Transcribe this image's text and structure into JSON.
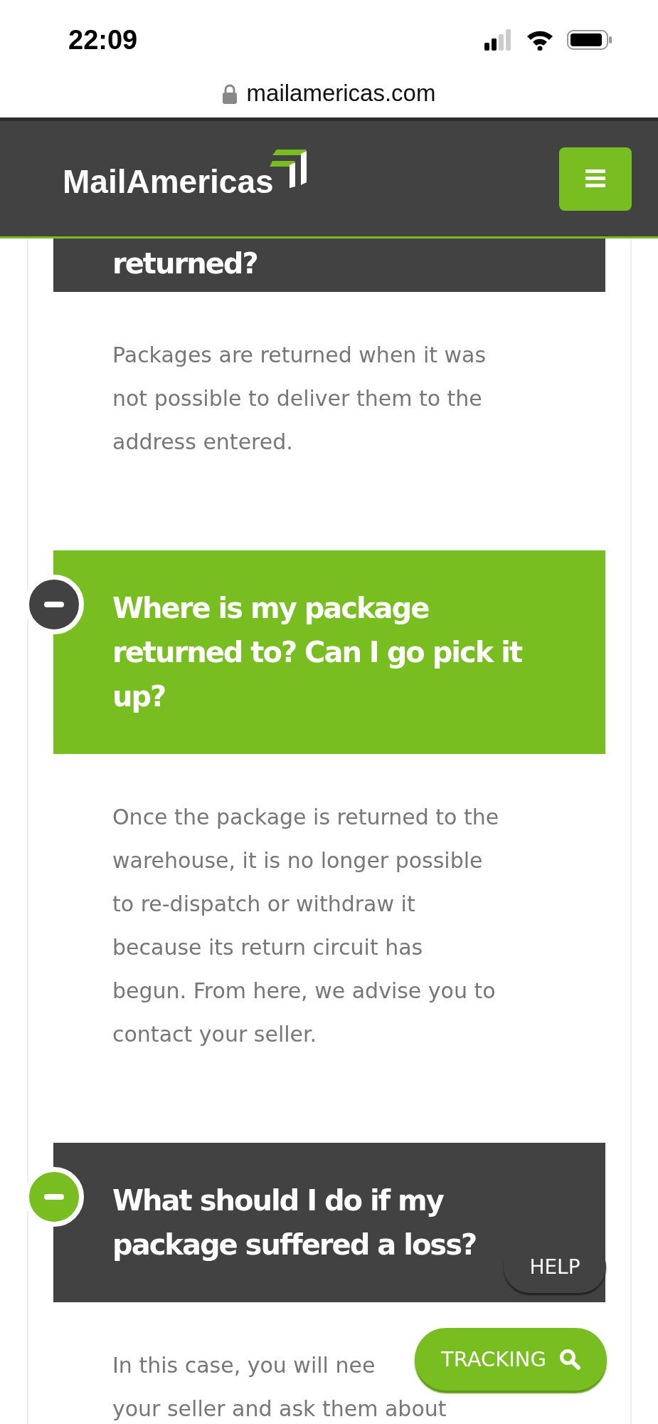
{
  "status_bar": {
    "time": "22:09"
  },
  "address_bar": {
    "url": "mailamericas.com",
    "secure": true
  },
  "header": {
    "logo": "MailAmericas"
  },
  "faq": [
    {
      "kind": "continued",
      "question": [
        "returned?"
      ],
      "expanded": true,
      "selected": false,
      "answer": [
        "Packages are returned when it was",
        "not possible to deliver them to the",
        "address entered."
      ]
    },
    {
      "kind": "full",
      "question": [
        "Where is my package",
        "returned to? Can I go pick it",
        "up?"
      ],
      "expanded": true,
      "selected": true,
      "answer": [
        "Once the package is returned to the",
        "warehouse, it is no longer possible",
        "to re-dispatch or withdraw it",
        "because its return circuit has",
        "begun. From here, we advise you to",
        "contact your seller."
      ]
    },
    {
      "kind": "full",
      "question": [
        "What should I do if my",
        "package suffered a loss?"
      ],
      "expanded": true,
      "selected": false,
      "answer": [
        "In this case, you will nee",
        "your seller and ask them about"
      ]
    }
  ],
  "help_button": {
    "label": "HELP"
  },
  "tracking_button": {
    "label": "TRACKING"
  }
}
